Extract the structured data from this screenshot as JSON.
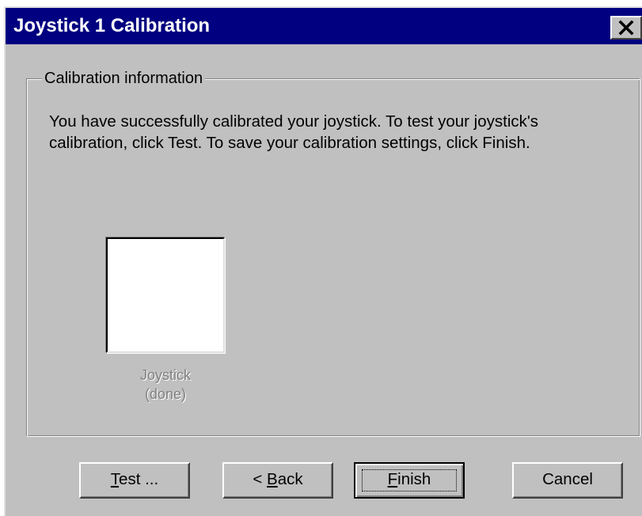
{
  "window": {
    "title": "Joystick 1 Calibration",
    "close_icon": "close-x-icon"
  },
  "group": {
    "label": "Calibration information",
    "message": "You have successfully calibrated your joystick. To test your joystick's calibration, click Test. To save your calibration settings, click Finish."
  },
  "joystick": {
    "label_line1": "Joystick",
    "label_line2": "(done)"
  },
  "buttons": {
    "test": {
      "mnemonic": "T",
      "rest": "est ..."
    },
    "back": {
      "prefix": "< ",
      "mnemonic": "B",
      "rest": "ack"
    },
    "finish": {
      "mnemonic": "F",
      "rest": "inish"
    },
    "cancel": {
      "label": "Cancel"
    }
  },
  "colors": {
    "titlebar": "#000080",
    "face": "#c0c0c0",
    "disabled_text": "#808080"
  }
}
